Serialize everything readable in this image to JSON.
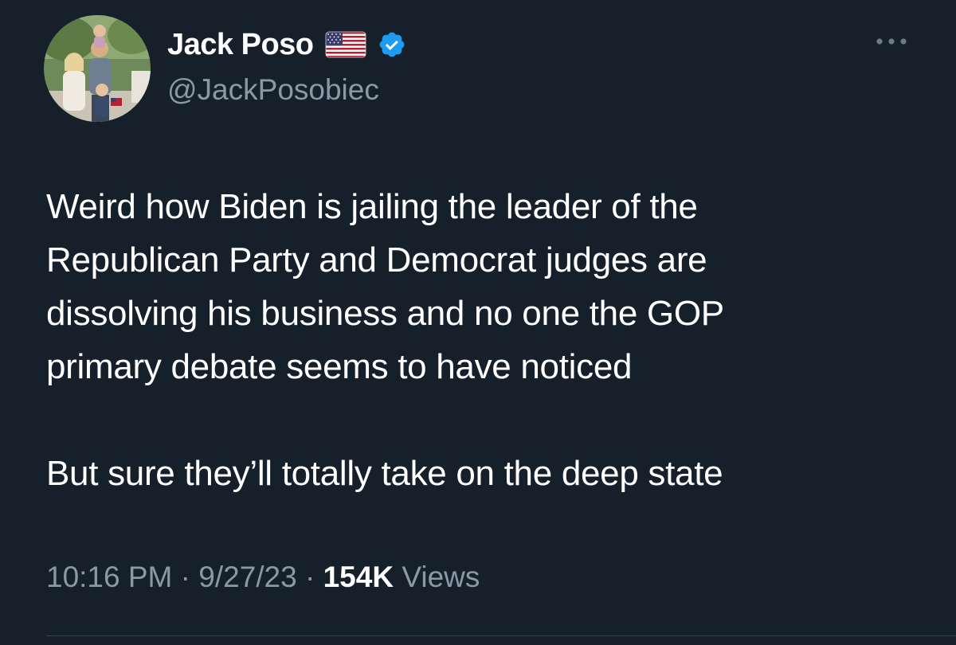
{
  "author": {
    "display_name": "Jack Poso",
    "handle": "@JackPosobiec",
    "badges": [
      "flag-usa-icon",
      "verified-icon"
    ],
    "verified_color": "#1d9bf0"
  },
  "tweet": {
    "text_lines": [
      "Weird how Biden is jailing the leader of the",
      "Republican Party and Democrat judges are",
      "dissolving his business and no one the GOP",
      "primary debate seems to have noticed"
    ],
    "closing_line": "But sure they’ll totally take on the deep state"
  },
  "meta": {
    "time": "10:16 PM",
    "separator": " · ",
    "date": "9/27/23",
    "views_count": "154K",
    "views_label": " Views"
  },
  "colors": {
    "background": "#15202b",
    "primary_text": "#ffffff",
    "secondary_text": "#8b98a5"
  }
}
